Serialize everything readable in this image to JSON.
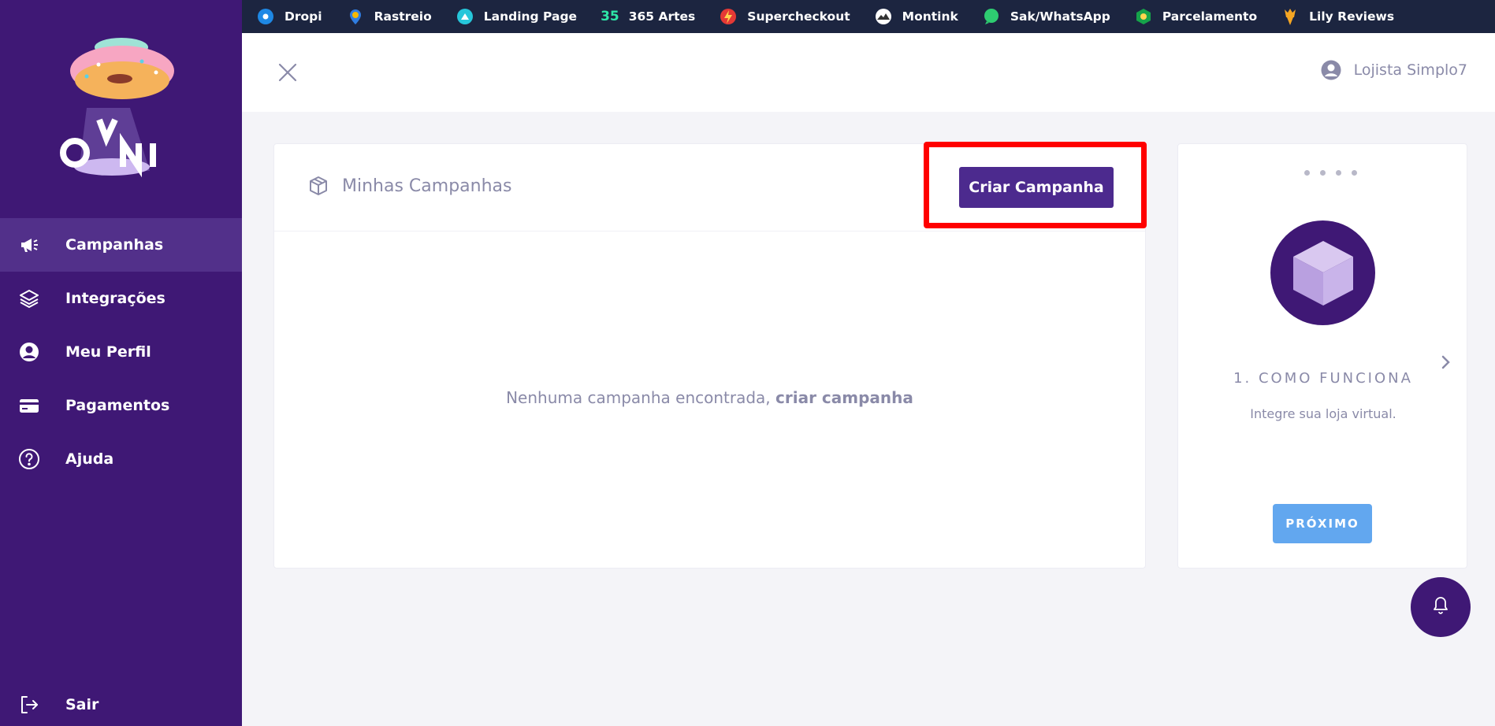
{
  "topbar": {
    "items": [
      {
        "label": "Dropi",
        "icon": "dropi-icon",
        "color": "#1e88e5"
      },
      {
        "label": "Rastreio",
        "icon": "rastreio-icon",
        "color": "#f5b800"
      },
      {
        "label": "Landing Page",
        "icon": "landing-page-icon",
        "color": "#26c6da"
      },
      {
        "label": "365 Artes",
        "icon": "365-artes-icon",
        "color": "#2ee6a8"
      },
      {
        "label": "Supercheckout",
        "icon": "supercheckout-icon",
        "color": "#e53935"
      },
      {
        "label": "Montink",
        "icon": "montink-icon",
        "color": "#ffffff"
      },
      {
        "label": "Sak/WhatsApp",
        "icon": "whatsapp-icon",
        "color": "#2ecc71"
      },
      {
        "label": "Parcelamento",
        "icon": "parcelamento-icon",
        "color": "#16a34a"
      },
      {
        "label": "Lily Reviews",
        "icon": "lily-reviews-icon",
        "color": "#f5a623"
      }
    ]
  },
  "sidebar": {
    "items": [
      {
        "label": "Campanhas",
        "icon": "megaphone-icon",
        "active": true
      },
      {
        "label": "Integrações",
        "icon": "layers-icon",
        "active": false
      },
      {
        "label": "Meu Perfil",
        "icon": "user-circle-icon",
        "active": false
      },
      {
        "label": "Pagamentos",
        "icon": "credit-card-icon",
        "active": false
      },
      {
        "label": "Ajuda",
        "icon": "help-circle-icon",
        "active": false
      }
    ],
    "logout_label": "Sair"
  },
  "header": {
    "user_name": "Lojista Simplo7"
  },
  "main": {
    "title": "Minhas Campanhas",
    "create_button": "Criar Campanha",
    "empty_text": "Nenhuma campanha encontrada,",
    "empty_link": "criar campanha"
  },
  "onboarding": {
    "step_title": "1. COMO FUNCIONA",
    "step_desc": "Integre sua loja virtual.",
    "next_button": "PRÓXIMO"
  },
  "colors": {
    "sidebar_bg": "#3f1875",
    "sidebar_active": "#52308a",
    "topbar_bg": "#1c2540",
    "primary_button": "#4c2a8e",
    "next_button": "#62a7ef",
    "highlight": "#ff0000"
  }
}
